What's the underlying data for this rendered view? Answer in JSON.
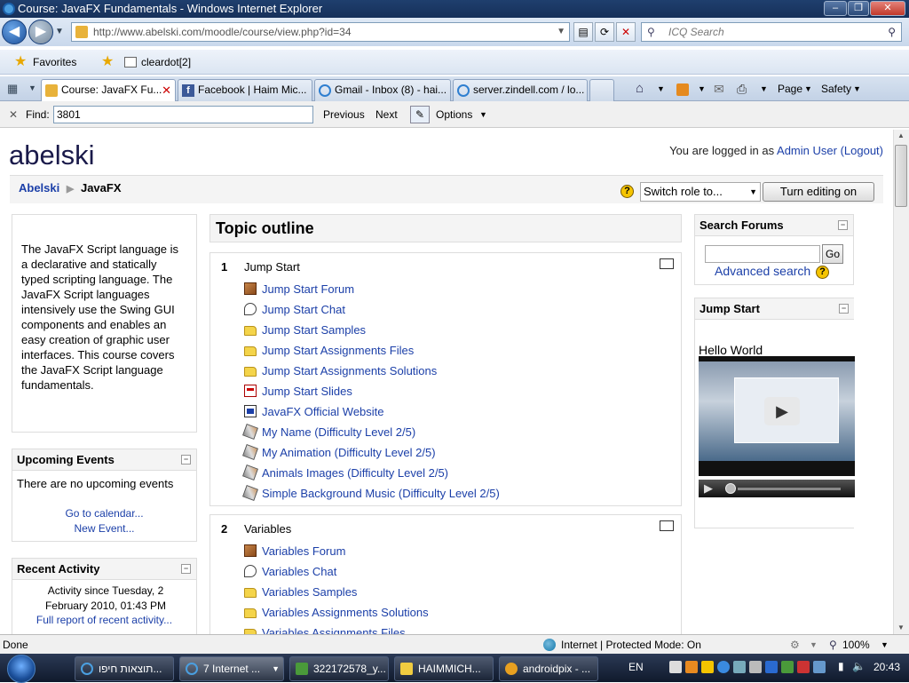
{
  "window": {
    "title": "Course: JavaFX Fundamentals - Windows Internet Explorer"
  },
  "address": {
    "url": "http://www.abelski.com/moodle/course/view.php?id=34",
    "search_placeholder": "ICQ Search"
  },
  "favorites": {
    "label": "Favorites",
    "items": [
      "cleardot[2]"
    ]
  },
  "tabs": [
    "Course: JavaFX Fu...",
    "Facebook | Haim Mic...",
    "Gmail - Inbox (8) - hai...",
    "server.zindell.com / lo..."
  ],
  "commandbar": {
    "page": "Page",
    "safety": "Safety"
  },
  "findbar": {
    "label": "Find:",
    "value": "3801",
    "previous": "Previous",
    "next": "Next",
    "options": "Options"
  },
  "site": {
    "logo": "abelski",
    "login_prefix": "You are logged in as",
    "user": "Admin User",
    "logout": "(Logout)",
    "breadcrumb_home": "Abelski",
    "breadcrumb_sep": "▶",
    "breadcrumb_current": "JavaFX",
    "switch_role": "Switch role to...",
    "turn_editing": "Turn editing on"
  },
  "left": {
    "summary": "The JavaFX Script language is a declarative and statically typed scripting language. The JavaFX Script languages intensively use the Swing GUI components and enables an easy creation of graphic user interfaces. This course covers the JavaFX Script language fundamentals.",
    "upcoming": {
      "title": "Upcoming Events",
      "empty": "There are no upcoming events",
      "calendar": "Go to calendar...",
      "new_event": "New Event..."
    },
    "recent": {
      "title": "Recent Activity",
      "since": "Activity since Tuesday, 2 February 2010, 01:43 PM",
      "report": "Full report of recent activity..."
    }
  },
  "main": {
    "outline_title": "Topic outline",
    "sections": [
      {
        "num": "1",
        "title": "Jump Start",
        "items": [
          {
            "icon": "forum",
            "label": "Jump Start Forum"
          },
          {
            "icon": "chat",
            "label": "Jump Start Chat"
          },
          {
            "icon": "folder",
            "label": "Jump Start Samples"
          },
          {
            "icon": "folder",
            "label": "Jump Start Assignments Files"
          },
          {
            "icon": "folder",
            "label": "Jump Start Assignments Solutions"
          },
          {
            "icon": "pdf",
            "label": "Jump Start Slides"
          },
          {
            "icon": "web",
            "label": "JavaFX Official Website"
          },
          {
            "icon": "assign",
            "label": "My Name (Difficulty Level 2/5)"
          },
          {
            "icon": "assign",
            "label": "My Animation (Difficulty Level 2/5)"
          },
          {
            "icon": "assign",
            "label": "Animals Images (Difficulty Level 2/5)"
          },
          {
            "icon": "assign",
            "label": "Simple Background Music (Difficulty Level 2/5)"
          }
        ]
      },
      {
        "num": "2",
        "title": "Variables",
        "items": [
          {
            "icon": "forum",
            "label": "Variables Forum"
          },
          {
            "icon": "chat",
            "label": "Variables Chat"
          },
          {
            "icon": "folder",
            "label": "Variables Samples"
          },
          {
            "icon": "folder",
            "label": "Variables Assignments Solutions"
          },
          {
            "icon": "folder",
            "label": "Variables Assignments Files"
          }
        ]
      }
    ]
  },
  "right": {
    "search": {
      "title": "Search Forums",
      "go": "Go",
      "advanced": "Advanced search"
    },
    "jumpstart": {
      "title": "Jump Start",
      "caption": "Hello World"
    }
  },
  "status": {
    "left": "Done",
    "zone": "Internet | Protected Mode: On",
    "zoom": "100%"
  },
  "taskbar": {
    "tasks": [
      "תוצאות חיפו...",
      "7 Internet ...",
      "322172578_y...",
      "HAIMMICH...",
      "androidpix - ..."
    ],
    "lang": "EN",
    "clock": "20:43"
  }
}
